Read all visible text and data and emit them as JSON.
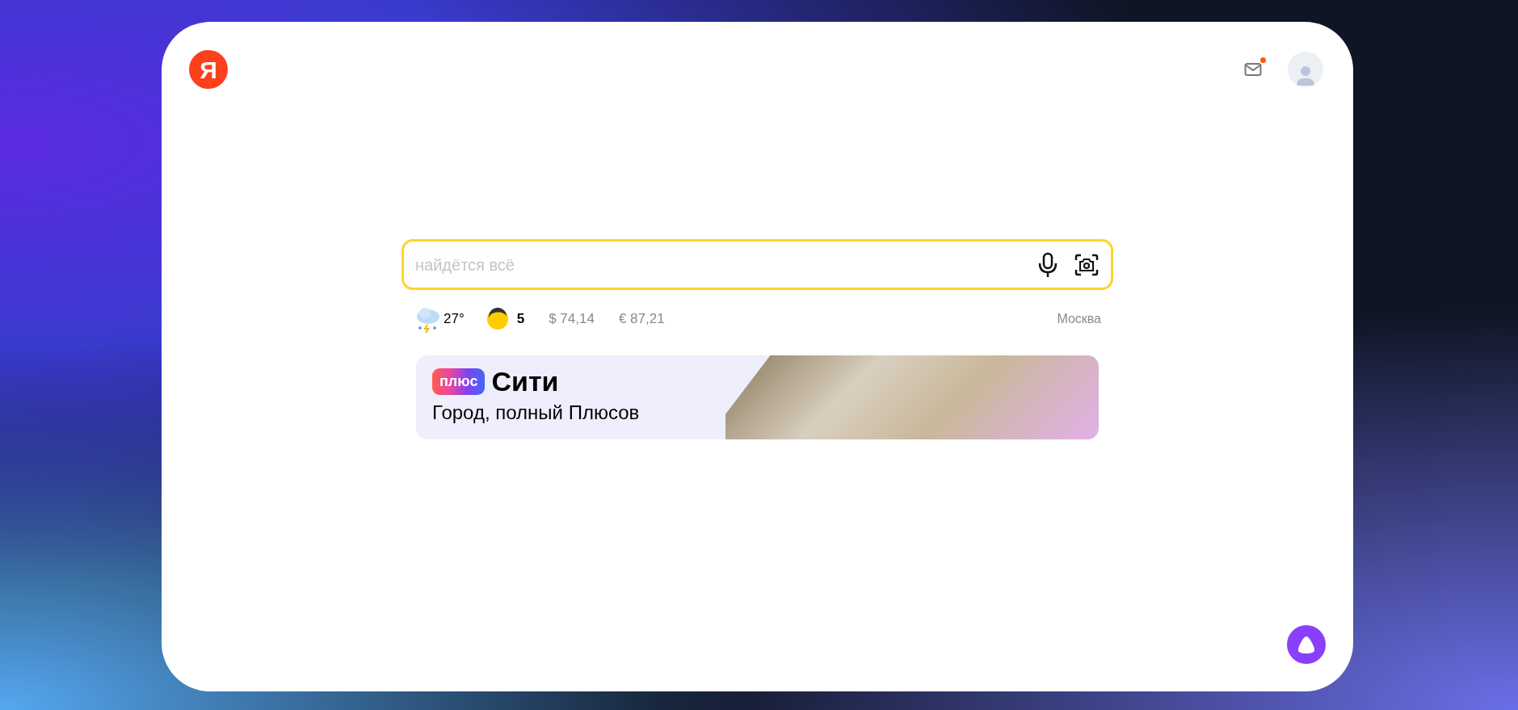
{
  "header": {
    "logo": "Я",
    "mail": {
      "has_notification": true
    }
  },
  "search": {
    "placeholder": "найдётся всё"
  },
  "informers": {
    "weather": "27°",
    "traffic": "5",
    "currencies": [
      "$ 74,14",
      "€ 87,21"
    ],
    "city": "Москва"
  },
  "banner": {
    "badge": "плюс",
    "title": "Сити",
    "subtitle": "Город, полный Плюсов"
  }
}
